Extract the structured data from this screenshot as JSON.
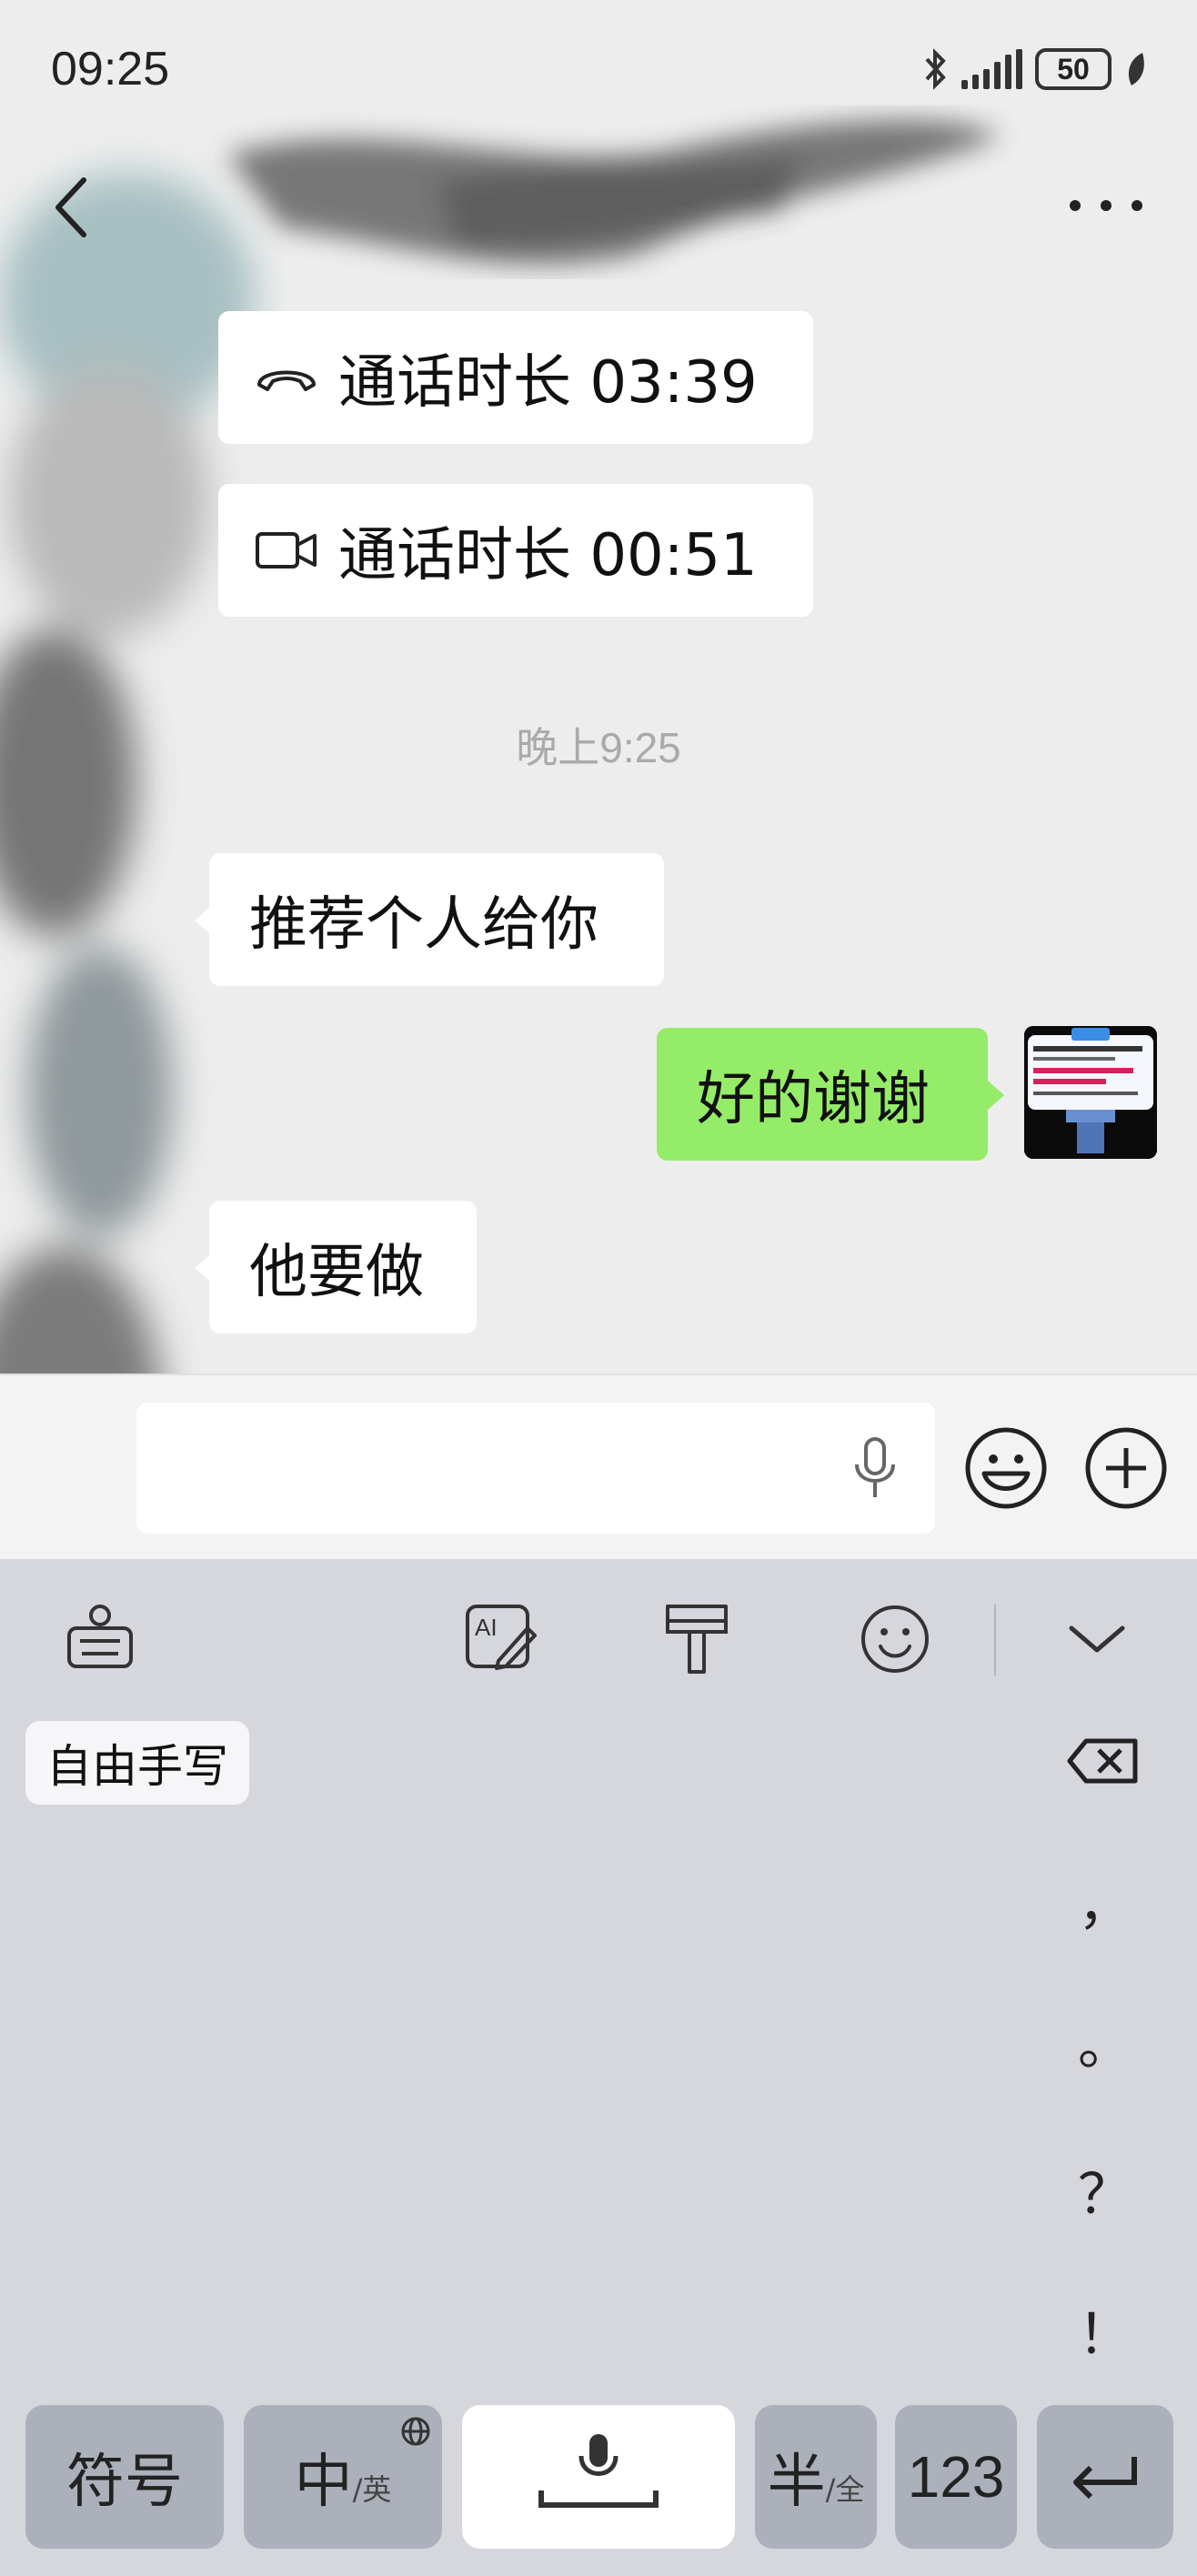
{
  "status_bar": {
    "time": "09:25",
    "battery": "50"
  },
  "chat": {
    "call_1": {
      "label": "通话时长 03:39",
      "icon": "phone-icon"
    },
    "call_2": {
      "label": "通话时长 00:51",
      "icon": "video-call-icon"
    },
    "timestamp": "晚上9:25",
    "messages": [
      {
        "side": "left",
        "text": "推荐个人给你"
      },
      {
        "side": "right",
        "text": "好的谢谢"
      },
      {
        "side": "left",
        "text": "他要做"
      }
    ]
  },
  "keyboard": {
    "toolbar_icons": [
      "keyboard-icon",
      "ai-icon",
      "brush-icon",
      "emoji-icon",
      "chevron-down-icon"
    ],
    "handwriting_label": "自由手写",
    "punctuation": [
      "，",
      "。",
      "？",
      "！"
    ],
    "bottom_row": {
      "symbols": "符号",
      "lang_main": "中",
      "lang_sub": "/英",
      "half_main": "半",
      "half_sub": "/全",
      "numbers": "123"
    }
  },
  "colors": {
    "sent_bubble": "#95ec69",
    "background": "#ededed",
    "keyboard_bg": "#d5d7dd"
  }
}
